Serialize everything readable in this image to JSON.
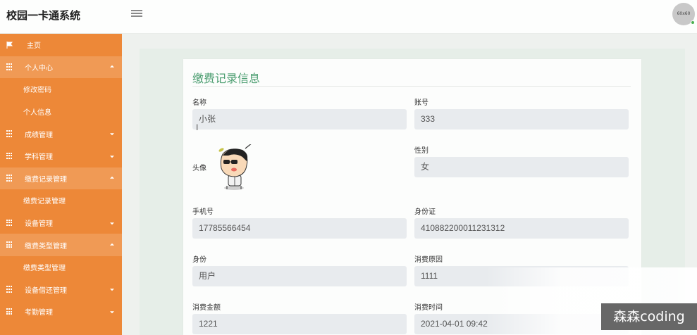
{
  "app": {
    "title": "校园一卡通系统"
  },
  "header": {
    "avatar_text": "60x60"
  },
  "sidebar": {
    "items": [
      {
        "label": "主页"
      },
      {
        "label": "个人中心"
      },
      {
        "label": "修改密码"
      },
      {
        "label": "个人信息"
      },
      {
        "label": "成绩管理"
      },
      {
        "label": "学科管理"
      },
      {
        "label": "缴费记录管理"
      },
      {
        "label": "缴费记录管理"
      },
      {
        "label": "设备管理"
      },
      {
        "label": "缴费类型管理"
      },
      {
        "label": "缴费类型管理"
      },
      {
        "label": "设备借还管理"
      },
      {
        "label": "考勤管理"
      }
    ]
  },
  "form": {
    "title": "缴费记录信息",
    "name_label": "名称",
    "name_value": "小张",
    "account_label": "账号",
    "account_value": "333",
    "avatar_label": "头像",
    "gender_label": "性别",
    "gender_value": "女",
    "phone_label": "手机号",
    "phone_value": "17785566454",
    "idcard_label": "身份证",
    "idcard_value": "410882200011231312",
    "identity_label": "身份",
    "identity_value": "用户",
    "reason_label": "消费原因",
    "reason_value": "1111",
    "amount_label": "消费金额",
    "amount_value": "1221",
    "time_label": "消费时间",
    "time_value": "2021-04-01 09:42"
  },
  "watermark": {
    "text": "森森coding"
  },
  "colors": {
    "sidebar": "#ed8838",
    "sidebar_active": "#f09a55",
    "title_green": "#4a9d6f",
    "input_bg": "#e8ebee"
  }
}
